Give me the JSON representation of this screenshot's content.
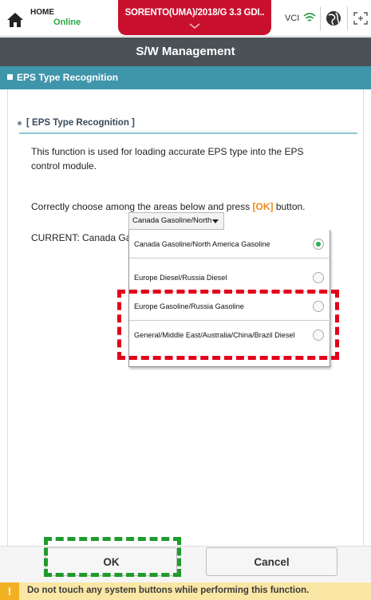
{
  "topbar": {
    "home_label": "HOME",
    "status": "Online",
    "vehicle": "SORENTO(UMA)/2018/G 3.3 GDI..",
    "vci_label": "VCI",
    "icons": [
      "home-icon",
      "chevron-down-icon",
      "wifi-icon",
      "globe-icon",
      "fullscreen-icon"
    ]
  },
  "title": "S/W Management",
  "section": "EPS Type Recognition",
  "content": {
    "subhead": "[ EPS Type Recognition ]",
    "p1": "This function is used for loading accurate EPS type into the EPS control module.",
    "p2_before": "Correctly choose among the areas below and press ",
    "p2_ok": "[OK]",
    "p2_after": " button.",
    "p3": "CURRENT: Canada Gasoline/North America Gasoline"
  },
  "dropdown": {
    "selected_display": "Canada Gasoline/North Am..",
    "options": [
      {
        "label": "Canada Gasoline/North America Gasoline",
        "selected": true
      },
      {
        "label": "Europe Diesel/Russia Diesel",
        "selected": false
      },
      {
        "label": "Europe Gasoline/Russia Gasoline",
        "selected": false
      },
      {
        "label": "General/Middle East/Australia/China/Brazil Diesel",
        "selected": false
      }
    ]
  },
  "buttons": {
    "ok": "OK",
    "cancel": "Cancel"
  },
  "warning": {
    "icon": "!",
    "text": "Do not touch any system buttons while performing this function."
  },
  "colors": {
    "vehicle_tab": "#c8102e",
    "title_bar": "#4a5258",
    "section_bar": "#3f95aa",
    "online": "#27a843",
    "ok_tag": "#f08a1a",
    "annotation_red": "#e2001a",
    "annotation_green": "#1e9b2b",
    "warning_bg": "#fbe7a5"
  }
}
